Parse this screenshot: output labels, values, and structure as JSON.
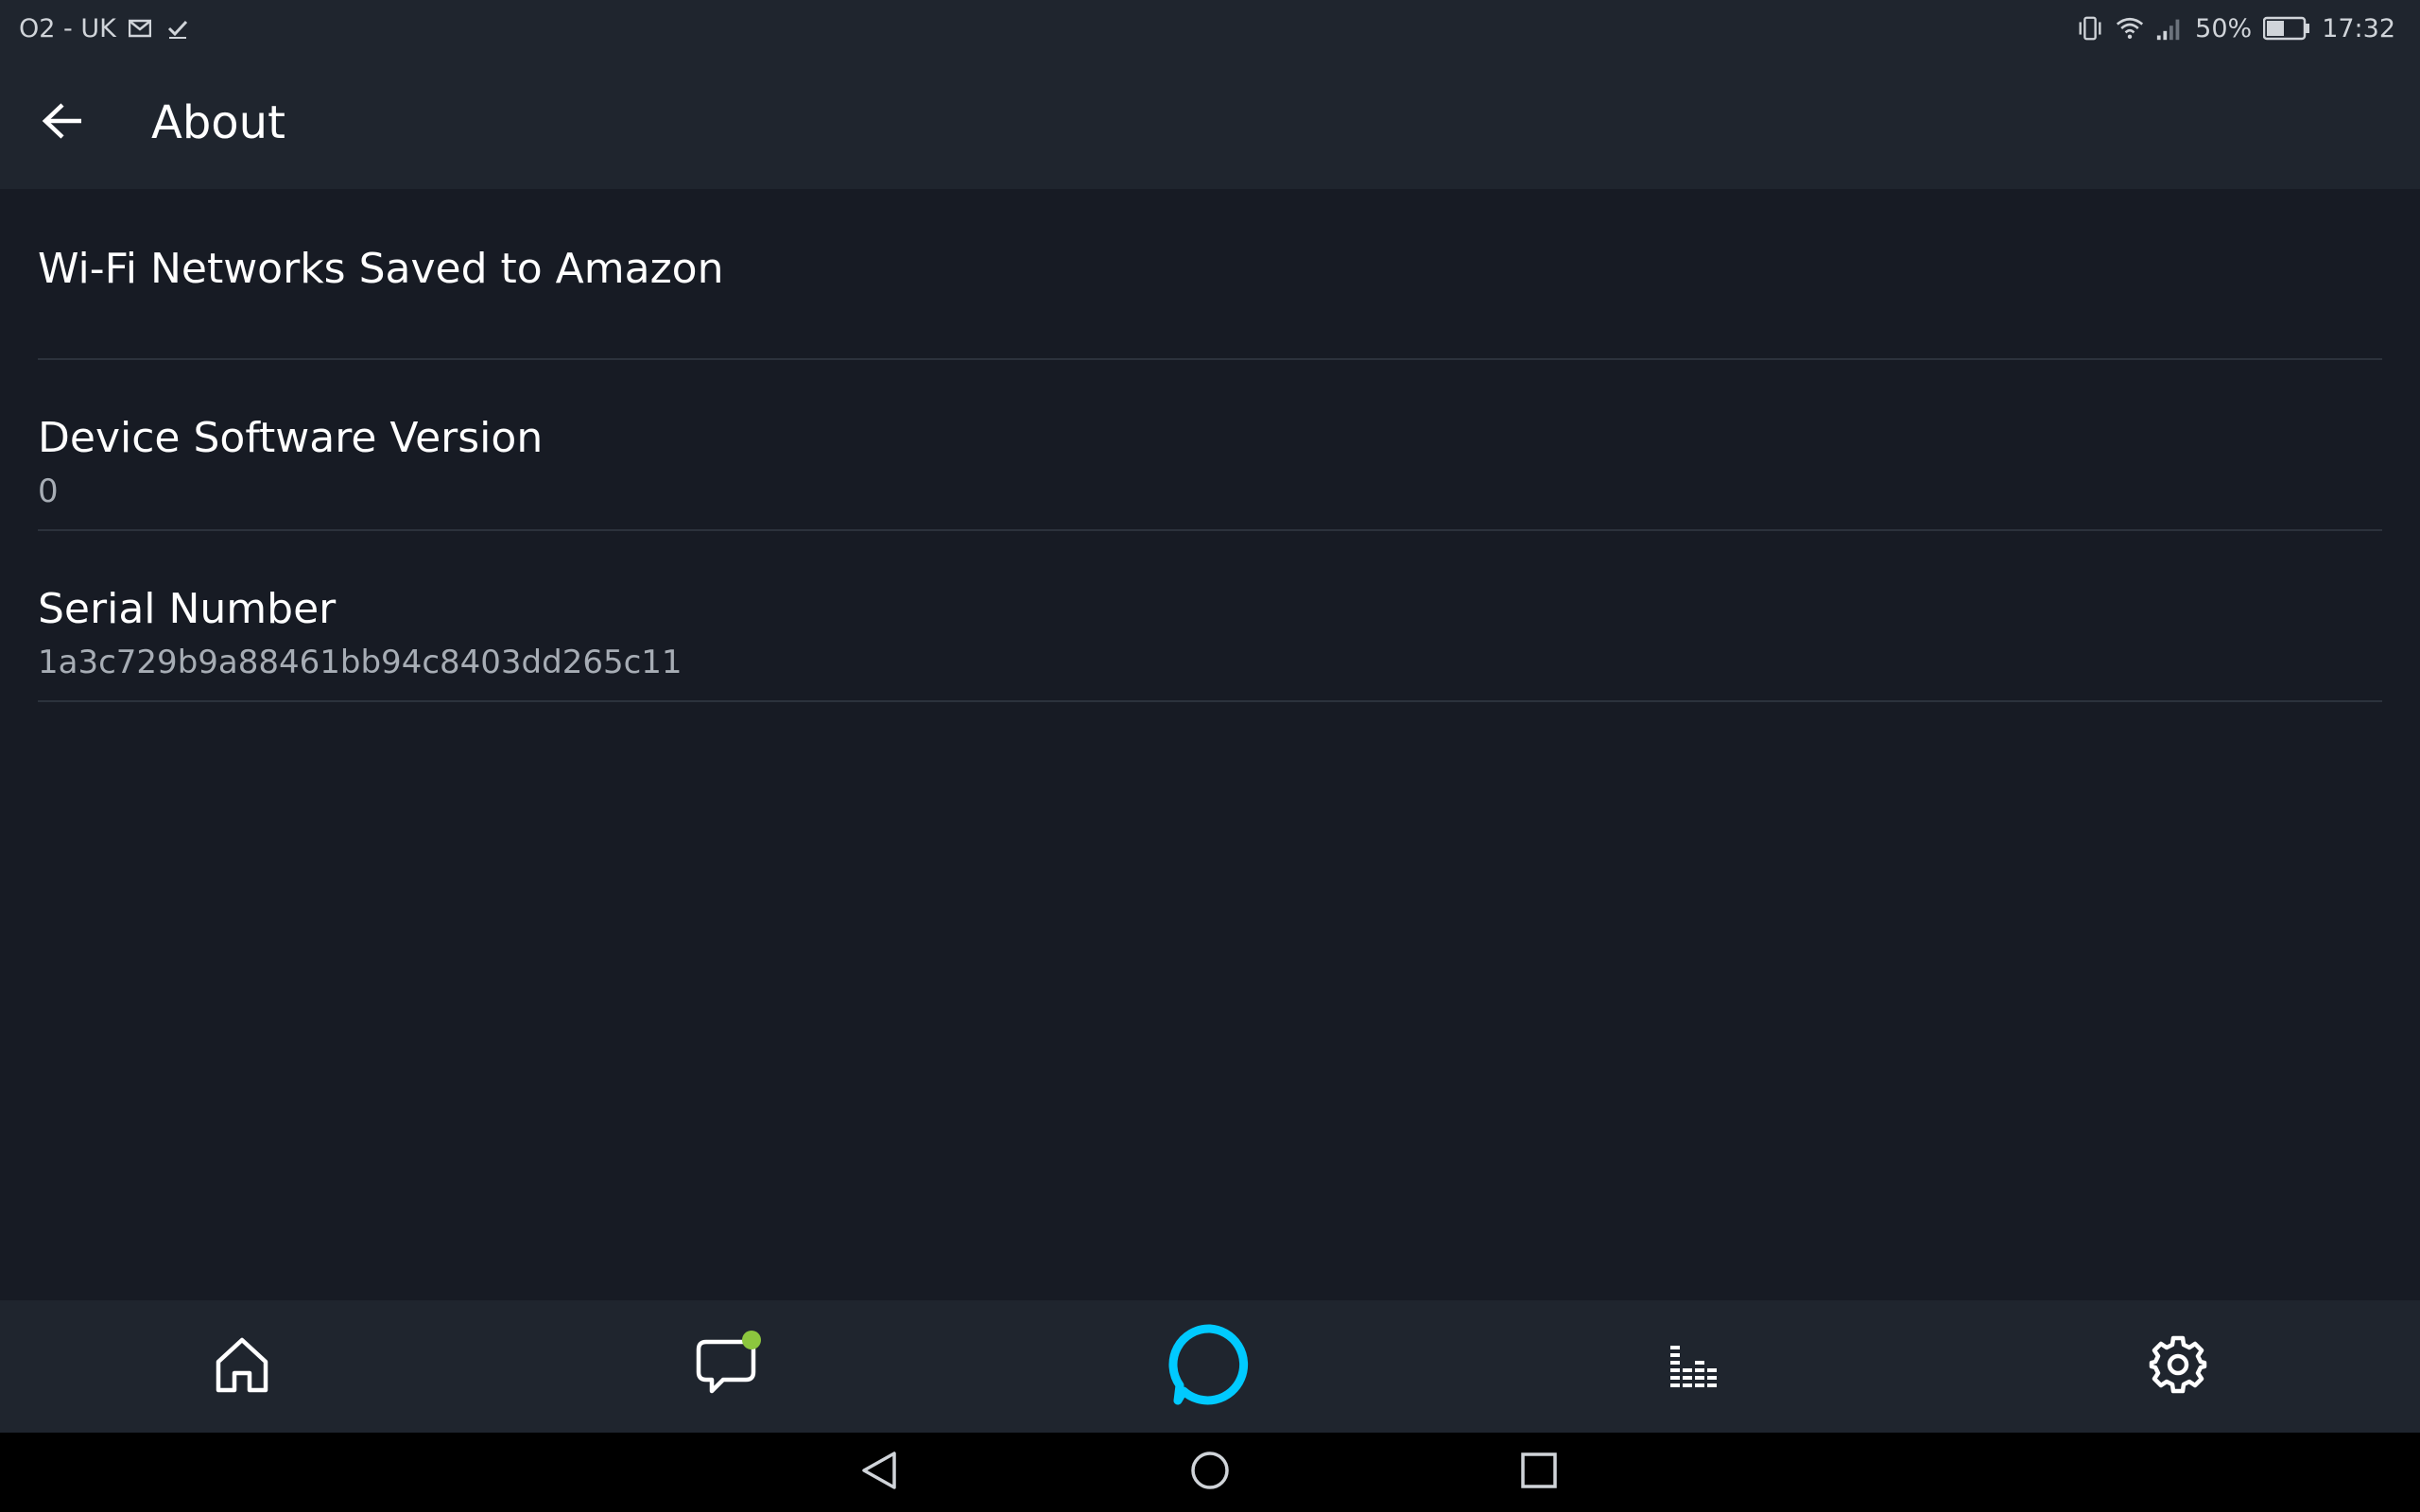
{
  "status_bar": {
    "carrier": "O2 - UK",
    "icons_left": [
      "gmail-icon",
      "check-icon"
    ],
    "icons_right": [
      "vibrate-icon",
      "wifi-icon",
      "signal-icon"
    ],
    "battery": "50%",
    "time": "17:32"
  },
  "app_bar": {
    "back_icon": "arrow-left-icon",
    "title": "About"
  },
  "items": [
    {
      "title": "Wi-Fi Networks Saved to Amazon"
    },
    {
      "title": "Device Software Version",
      "value": "0"
    },
    {
      "title": "Serial Number",
      "value": "1a3c729b9a88461bb94c8403dd265c11"
    }
  ],
  "bottom_nav": [
    {
      "icon": "home-icon"
    },
    {
      "icon": "chat-icon",
      "badge": true
    },
    {
      "icon": "alexa-icon"
    },
    {
      "icon": "play-bars-icon"
    },
    {
      "icon": "gear-icon"
    }
  ],
  "system_nav": [
    "back-triangle-icon",
    "home-circle-icon",
    "recents-square-icon"
  ],
  "colors": {
    "background": "#171b24",
    "bar": "#1f252e",
    "alexa_accent": "#00caff",
    "badge": "#8cc63e",
    "subtext": "#a7adb5"
  }
}
